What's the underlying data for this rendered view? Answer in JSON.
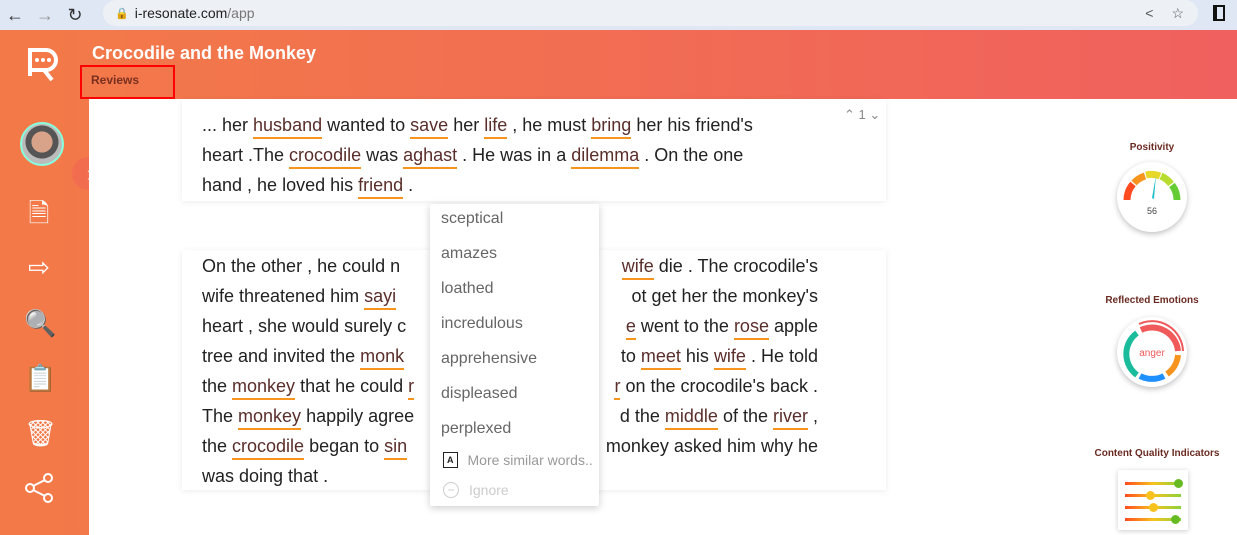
{
  "browser": {
    "url_host": "i-resonate.com",
    "url_path": "/app",
    "back_icon": "arrow-left-icon",
    "forward_icon": "arrow-right-icon",
    "reload_icon": "reload-icon"
  },
  "header": {
    "title": "Crocodile and the Monkey",
    "breadcrumb": "Reviews"
  },
  "counter": {
    "value": "1"
  },
  "paragraphs": [
    {
      "lines": [
        [
          [
            [
              "... her "
            ],
            [
              "husband",
              1
            ],
            [
              " wanted to "
            ],
            [
              "save",
              1
            ],
            [
              " her "
            ],
            [
              "life",
              1
            ],
            [
              " , he must "
            ],
            [
              "bring",
              1
            ],
            [
              " her his friend's"
            ]
          ],
          []
        ],
        [
          [
            [
              "heart .The "
            ],
            [
              "crocodile",
              1
            ],
            [
              " was "
            ],
            [
              "aghast",
              1
            ],
            [
              " . He was in a "
            ],
            [
              "dilemma",
              1
            ],
            [
              " . On the one"
            ]
          ],
          []
        ],
        [
          [
            [
              "hand , he loved his "
            ],
            [
              "friend",
              1
            ],
            [
              " ."
            ]
          ],
          []
        ]
      ]
    },
    {
      "lines": [
        [
          [
            [
              "On the other , he could n"
            ]
          ],
          [
            [
              "wife",
              1
            ],
            [
              " die . The crocodile's"
            ]
          ]
        ],
        [
          [
            [
              "wife threatened him "
            ],
            [
              "sayi",
              1
            ]
          ],
          [
            [
              "ot get her the monkey's"
            ]
          ]
        ],
        [
          [
            [
              "heart , she would surely c"
            ]
          ],
          [
            [
              "e",
              1
            ],
            [
              " went to the "
            ],
            [
              "rose",
              1
            ],
            [
              " apple"
            ]
          ]
        ],
        [
          [
            [
              "tree and invited the "
            ],
            [
              "monk",
              1
            ]
          ],
          [
            [
              "to "
            ],
            [
              "meet",
              1
            ],
            [
              " his "
            ],
            [
              "wife",
              1
            ],
            [
              " . He told"
            ]
          ]
        ],
        [
          [
            [
              "the "
            ],
            [
              "monkey",
              1
            ],
            [
              " that he could "
            ],
            [
              "r",
              1
            ]
          ],
          [
            [
              "r",
              1
            ],
            [
              " on the crocodile's back ."
            ]
          ]
        ],
        [
          [
            [
              "The "
            ],
            [
              "monkey",
              1
            ],
            [
              " happily agree"
            ]
          ],
          [
            [
              "d the "
            ],
            [
              "middle",
              1
            ],
            [
              " of the "
            ],
            [
              "river",
              1
            ],
            [
              " ,"
            ]
          ]
        ],
        [
          [
            [
              "the "
            ],
            [
              "crocodile",
              1
            ],
            [
              " began to "
            ],
            [
              "sin",
              1
            ]
          ],
          [
            [
              "monkey asked him why he"
            ]
          ]
        ],
        [
          [
            [
              "was doing that ."
            ]
          ],
          []
        ]
      ]
    }
  ],
  "suggestions": {
    "items": [
      "sceptical",
      "amazes",
      "loathed",
      "incredulous",
      "apprehensive",
      "displeased",
      "perplexed"
    ],
    "more": "More similar words..",
    "ignore": "Ignore"
  },
  "panel": {
    "positivity": {
      "title": "Positivity",
      "value": "56"
    },
    "emotions": {
      "title": "Reflected Emotions",
      "label": "anger"
    },
    "quality": {
      "title": "Content Quality Indicators",
      "levels": [
        0.95,
        0.45,
        0.5,
        0.9
      ]
    }
  },
  "colors": {
    "accent": "#f7941d",
    "brand_start": "#f37a48",
    "brand_end": "#f0605e"
  }
}
